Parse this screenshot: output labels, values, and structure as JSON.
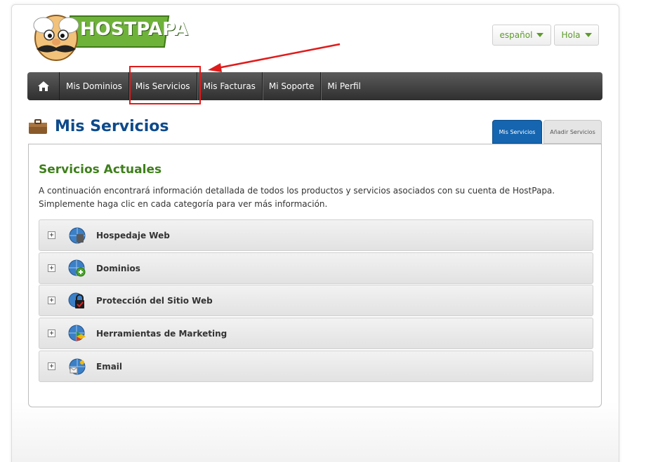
{
  "brand": {
    "logo_text": "HOSTPAPA"
  },
  "header": {
    "language_label": "español",
    "greeting_label": "Hola"
  },
  "nav": {
    "home_icon": "home-icon",
    "items": [
      {
        "label": "Mis Dominios"
      },
      {
        "label": "Mis Servicios"
      },
      {
        "label": "Mis Facturas"
      },
      {
        "label": "Mi Soporte"
      },
      {
        "label": "Mi Perfil"
      }
    ]
  },
  "page": {
    "title": "Mis Servicios",
    "title_icon": "briefcase-icon",
    "tabs": [
      {
        "label": "Mis Servicios",
        "active": true
      },
      {
        "label": "Añadir Servicios",
        "active": false
      }
    ]
  },
  "content": {
    "section_title": "Servicios Actuales",
    "intro_line1": "A continuación encontrará información detallada de todos los productos y servicios asociados con su cuenta de HostPapa.",
    "intro_line2": "Simplemente haga clic en cada categoría para ver más información.",
    "categories": [
      {
        "label": "Hospedaje Web",
        "icon": "globe-server-icon"
      },
      {
        "label": "Dominios",
        "icon": "globe-add-icon"
      },
      {
        "label": "Protección del Sitio Web",
        "icon": "globe-lock-icon"
      },
      {
        "label": "Herramientas de Marketing",
        "icon": "globe-play-icon"
      },
      {
        "label": "Email",
        "icon": "globe-mail-icon"
      }
    ]
  },
  "colors": {
    "brand_green": "#6fb23a",
    "title_blue": "#0d4a8a",
    "section_green": "#3f7f1c",
    "annotation_red": "#e01b1b"
  }
}
